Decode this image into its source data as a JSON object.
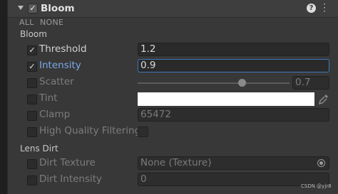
{
  "header": {
    "enabled": true,
    "title": "Bloom",
    "help_icon": "help-icon",
    "menu_icon": "kebab-menu-icon"
  },
  "toggles": {
    "all": "ALL",
    "none": "NONE"
  },
  "sections": {
    "bloom": "Bloom",
    "lens_dirt": "Lens Dirt"
  },
  "fields": {
    "threshold": {
      "label": "Threshold",
      "override": true,
      "value": "1.2"
    },
    "intensity": {
      "label": "Intensity",
      "override": true,
      "value": "0.9"
    },
    "scatter": {
      "label": "Scatter",
      "override": false,
      "value": "0.7",
      "slider_fraction": 0.7
    },
    "tint": {
      "label": "Tint",
      "override": false,
      "color": "#ffffff"
    },
    "clamp": {
      "label": "Clamp",
      "override": false,
      "value": "65472"
    },
    "high_quality_filtering": {
      "label": "High Quality Filtering",
      "override": false,
      "value": false
    },
    "dirt_texture": {
      "label": "Dirt Texture",
      "override": false,
      "value": "None (Texture)"
    },
    "dirt_intensity": {
      "label": "Dirt Intensity",
      "override": false,
      "value": "0"
    }
  },
  "colors": {
    "panel": "#383838",
    "accent": "#3a79bb",
    "active_label": "#7aa9e8"
  },
  "watermark": "CSDN @yjr8"
}
